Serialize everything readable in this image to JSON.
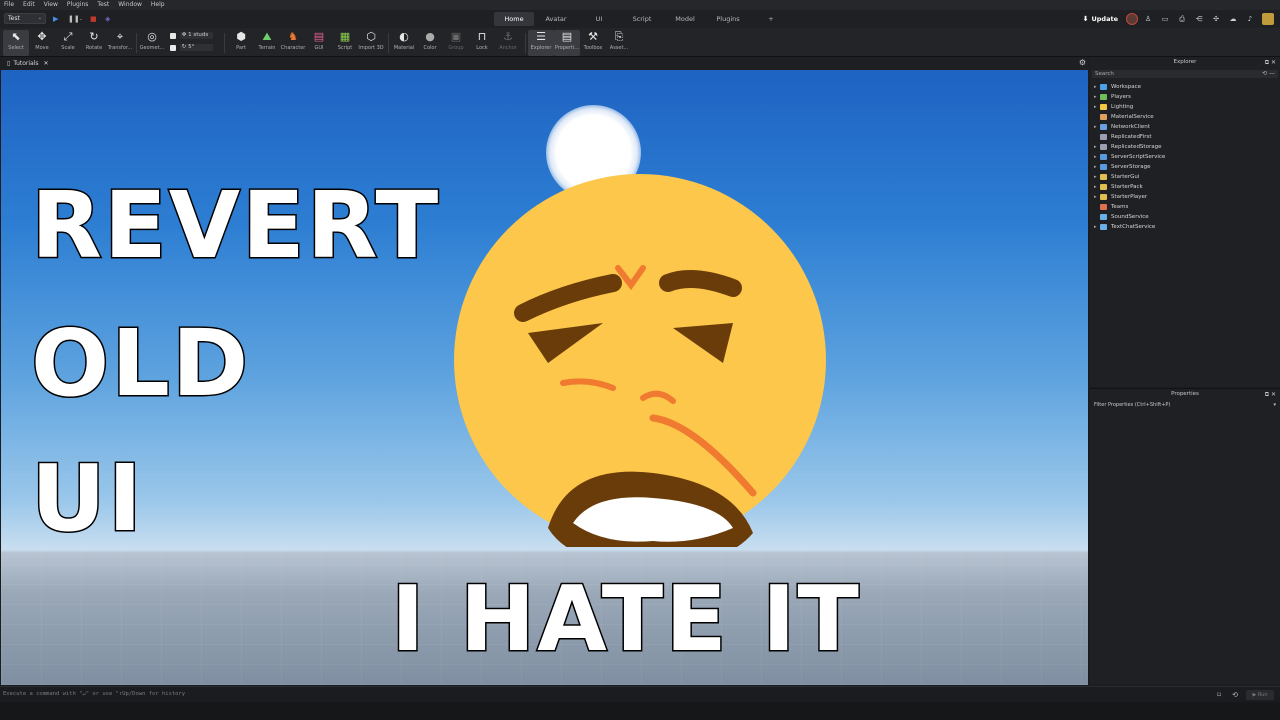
{
  "menu": [
    "File",
    "Edit",
    "View",
    "Plugins",
    "Test",
    "Window",
    "Help"
  ],
  "mode": {
    "value": "Test"
  },
  "ribbon_tabs": [
    {
      "label": "Home",
      "active": true
    },
    {
      "label": "Avatar",
      "active": false
    },
    {
      "label": "UI",
      "active": false
    },
    {
      "label": "Script",
      "active": false
    },
    {
      "label": "Model",
      "active": false
    },
    {
      "label": "Plugins",
      "active": false
    },
    {
      "label": "+",
      "active": false
    }
  ],
  "update_label": "Update",
  "tools": {
    "select": "Select",
    "move": "Move",
    "scale": "Scale",
    "rotate": "Rotate",
    "transform": "Transfor...",
    "geometry": "Geomet...",
    "part": "Part",
    "terrain": "Terrain",
    "character": "Character",
    "gui": "GUI",
    "script": "Script",
    "import3d": "Import 3D",
    "material": "Material",
    "color": "Color",
    "group": "Group",
    "lock": "Lock",
    "anchor": "Anchor",
    "explorer": "Explorer",
    "properties": "Properti...",
    "toolbox": "Toolbox",
    "assets": "Asset..."
  },
  "snap": {
    "move_value": "1 studs",
    "rotate_value": "5°"
  },
  "viewport_tab": "Tutorials",
  "overlay": {
    "line1": "REVERT",
    "line2": "OLD",
    "line3": "UI",
    "bottom": "I HATE IT"
  },
  "explorer": {
    "title": "Explorer",
    "search_placeholder": "Search",
    "items": [
      {
        "label": "Workspace",
        "expandable": true,
        "color": "#4aa3e8"
      },
      {
        "label": "Players",
        "expandable": true,
        "color": "#6fbf5a"
      },
      {
        "label": "Lighting",
        "expandable": true,
        "color": "#f2c744"
      },
      {
        "label": "MaterialService",
        "expandable": false,
        "color": "#e0a060"
      },
      {
        "label": "NetworkClient",
        "expandable": true,
        "color": "#6aa0e0"
      },
      {
        "label": "ReplicatedFirst",
        "expandable": false,
        "color": "#9aa0b0"
      },
      {
        "label": "ReplicatedStorage",
        "expandable": true,
        "color": "#9aa0b0"
      },
      {
        "label": "ServerScriptService",
        "expandable": true,
        "color": "#5a9be0"
      },
      {
        "label": "ServerStorage",
        "expandable": true,
        "color": "#5a9be0"
      },
      {
        "label": "StarterGui",
        "expandable": true,
        "color": "#e0c050"
      },
      {
        "label": "StarterPack",
        "expandable": true,
        "color": "#e0c050"
      },
      {
        "label": "StarterPlayer",
        "expandable": true,
        "color": "#e0c050"
      },
      {
        "label": "Teams",
        "expandable": false,
        "color": "#e07050"
      },
      {
        "label": "SoundService",
        "expandable": false,
        "color": "#6ab0e8"
      },
      {
        "label": "TextChatService",
        "expandable": true,
        "color": "#6ab0e8"
      }
    ]
  },
  "properties": {
    "title": "Properties",
    "filter_placeholder": "Filter Properties (Ctrl+Shift+P)"
  },
  "command_bar": {
    "placeholder": "Execute a command with \"↵\" or use \"↑Up/Down for history",
    "run_label": "Run"
  }
}
